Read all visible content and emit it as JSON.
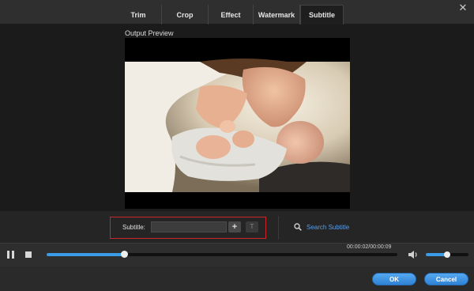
{
  "tabs": [
    {
      "label": "Trim"
    },
    {
      "label": "Crop"
    },
    {
      "label": "Effect"
    },
    {
      "label": "Watermark"
    },
    {
      "label": "Subtitle",
      "active": true
    }
  ],
  "preview": {
    "label": "Output Preview"
  },
  "subtitle": {
    "label": "Subtitle:",
    "value": "",
    "add_icon": "plus-icon",
    "font_icon": "text-style-icon",
    "search_label": "Search Subtitle",
    "search_icon": "search-icon"
  },
  "player": {
    "time": "00:00:02/00:00:09",
    "progress_fraction": 0.22,
    "volume_fraction": 0.5
  },
  "footer": {
    "ok_label": "OK",
    "cancel_label": "Cancel"
  },
  "colors": {
    "accent": "#3a9be6",
    "highlight_box": "#c8262a",
    "link": "#5b9ee4"
  }
}
